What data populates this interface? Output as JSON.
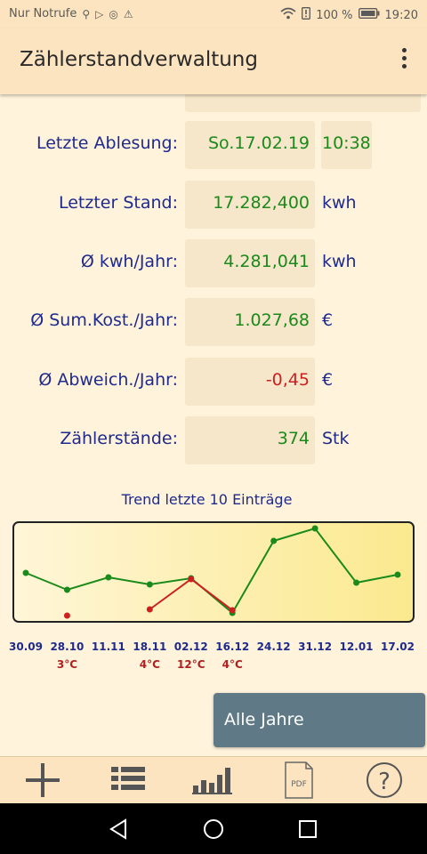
{
  "status": {
    "carrier": "Nur Notrufe",
    "battery": "100 %",
    "time": "19:20"
  },
  "app": {
    "title": "Zählerstandverwaltung"
  },
  "rows": [
    {
      "label": "Letzte Ablesung:",
      "value": "So.17.02.19",
      "time": "10:38"
    },
    {
      "label": "Letzter Stand:",
      "value": "17.282,400",
      "unit": "kwh"
    },
    {
      "label": "Ø kwh/Jahr:",
      "value": "4.281,041",
      "unit": "kwh"
    },
    {
      "label": "Ø Sum.Kost./Jahr:",
      "value": "1.027,68",
      "unit": "€"
    },
    {
      "label": "Ø Abweich./Jahr:",
      "value": "-0,45",
      "unit": "€"
    },
    {
      "label": "Zählerstände:",
      "value": "374",
      "unit": "Stk"
    }
  ],
  "colors": {
    "label": "#1e2a8c",
    "value_positive": "#1a8a1a",
    "value_negative": "#cc2020",
    "trend_line": "#1a8a1a",
    "temp_line": "#cc2020",
    "button_bg": "#5f7a86"
  },
  "chart_data": {
    "type": "line",
    "title": "Trend letzte 10 Einträge",
    "categories": [
      "30.09",
      "28.10",
      "11.11",
      "18.11",
      "02.12",
      "16.12",
      "24.12",
      "31.12",
      "12.01",
      "17.02"
    ],
    "temperatures": [
      "",
      "3°C",
      "",
      "4°C",
      "12°C",
      "4°C",
      "",
      "",
      "",
      ""
    ],
    "series": [
      {
        "values": [
          54,
          35,
          49,
          41,
          48,
          9,
          90,
          104,
          43,
          52
        ]
      },
      {
        "values": [
          null,
          6,
          null,
          13,
          47,
          12,
          null,
          null,
          null,
          null
        ]
      }
    ],
    "ylim": [
      0,
      110
    ]
  },
  "button": {
    "alle_jahre": "Alle Jahre"
  },
  "bottombar": {
    "items": [
      "add-icon",
      "list-icon",
      "bar-chart-icon",
      "pdf-icon",
      "help-icon"
    ],
    "pdf_label": "PDF",
    "help_label": "?"
  }
}
